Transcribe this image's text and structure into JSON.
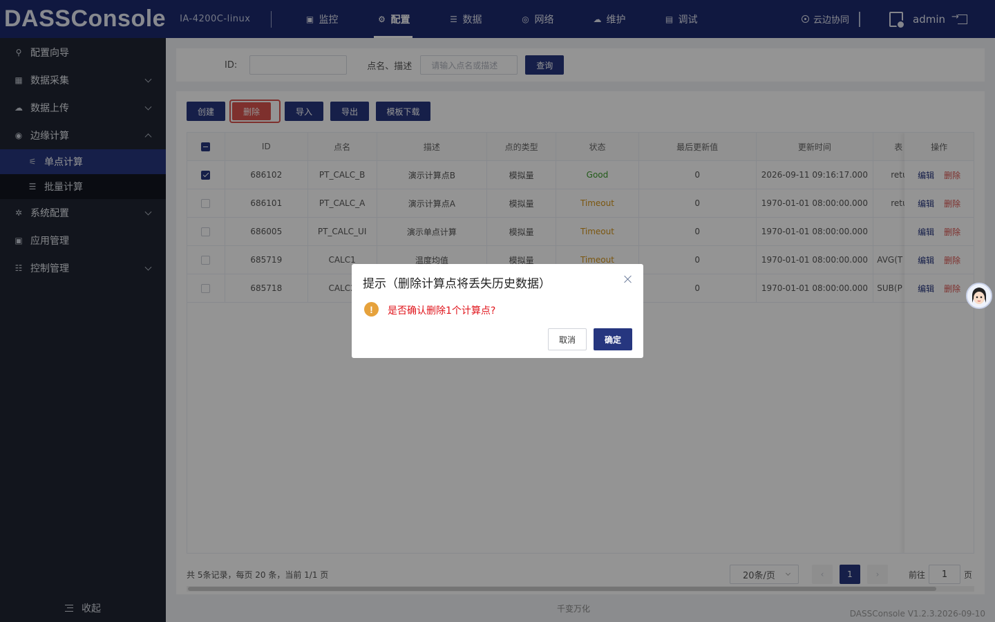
{
  "header": {
    "logo": "DASSConsole",
    "device": "IA-4200C-linux",
    "nav": [
      {
        "label": "监控",
        "icon": "monitor-icon"
      },
      {
        "label": "配置",
        "icon": "gear-icon"
      },
      {
        "label": "数据",
        "icon": "database-icon"
      },
      {
        "label": "网络",
        "icon": "network-icon"
      },
      {
        "label": "维护",
        "icon": "cloud-icon"
      },
      {
        "label": "调试",
        "icon": "debug-icon"
      }
    ],
    "active_nav": "配置",
    "cloud_sync": "云边协同",
    "user": "admin"
  },
  "sidebar": {
    "items": [
      {
        "label": "配置向导",
        "icon": "wizard-icon"
      },
      {
        "label": "数据采集",
        "icon": "collect-icon"
      },
      {
        "label": "数据上传",
        "icon": "upload-icon"
      },
      {
        "label": "边缘计算",
        "icon": "edge-compute-icon"
      },
      {
        "label": "系统配置",
        "icon": "settings-icon"
      },
      {
        "label": "应用管理",
        "icon": "apps-icon"
      },
      {
        "label": "控制管理",
        "icon": "control-icon"
      }
    ],
    "sub_items": [
      {
        "label": "单点计算",
        "icon": "single-calc-icon"
      },
      {
        "label": "批量计算",
        "icon": "batch-calc-icon"
      }
    ],
    "collapse": "收起"
  },
  "search": {
    "id_label": "ID:",
    "id_value": "",
    "name_label": "点名、描述",
    "name_placeholder": "请输入点名或描述",
    "query": "查询"
  },
  "toolbar": {
    "create": "创建",
    "delete": "删除",
    "import": "导入",
    "export": "导出",
    "template": "模板下载"
  },
  "table": {
    "headers": [
      "ID",
      "点名",
      "描述",
      "点的类型",
      "状态",
      "最后更新值",
      "更新时间",
      "表",
      "操作"
    ],
    "rows": [
      {
        "id": "686102",
        "name": "PT_CALC_B",
        "desc": "演示计算点B",
        "type": "模拟量",
        "status": "Good",
        "value": "0",
        "time": "2026-09-11 09:16:17.000",
        "expr": "retu",
        "checked": true
      },
      {
        "id": "686101",
        "name": "PT_CALC_A",
        "desc": "演示计算点A",
        "type": "模拟量",
        "status": "Timeout",
        "value": "0",
        "time": "1970-01-01 08:00:00.000",
        "expr": "retu",
        "checked": false
      },
      {
        "id": "686005",
        "name": "PT_CALC_UI",
        "desc": "演示单点计算",
        "type": "模拟量",
        "status": "Timeout",
        "value": "0",
        "time": "1970-01-01 08:00:00.000",
        "expr": "",
        "checked": false
      },
      {
        "id": "685719",
        "name": "CALC1",
        "desc": "温度均值",
        "type": "模拟量",
        "status": "Timeout",
        "value": "0",
        "time": "1970-01-01 08:00:00.000",
        "expr": "AVG(T",
        "checked": false
      },
      {
        "id": "685718",
        "name": "CALC2",
        "desc": "",
        "type": "",
        "status": "",
        "value": "0",
        "time": "1970-01-01 08:00:00.000",
        "expr": "SUB(P",
        "checked": false
      }
    ],
    "edit": "编辑",
    "delete": "删除"
  },
  "pagination": {
    "summary": "共 5条记录，每页 20 条，当前 1/1 页",
    "page_size": "20条/页",
    "current": "1",
    "goto_label": "前往",
    "goto_value": "1",
    "page_unit": "页"
  },
  "footer": {
    "center": "千变万化",
    "version": "DASSConsole V1.2.3.2026-09-10"
  },
  "dialog": {
    "title": "提示（删除计算点将丢失历史数据）",
    "message": "是否确认删除1个计算点?",
    "cancel": "取消",
    "confirm": "确定"
  },
  "colors": {
    "header_bg": "#1d2a6f",
    "sidebar_bg": "#1f2532",
    "primary": "#26367f",
    "danger": "#d9534f",
    "good": "#3a9b2a",
    "timeout": "#d4951a",
    "warning": "#e6a23c"
  }
}
